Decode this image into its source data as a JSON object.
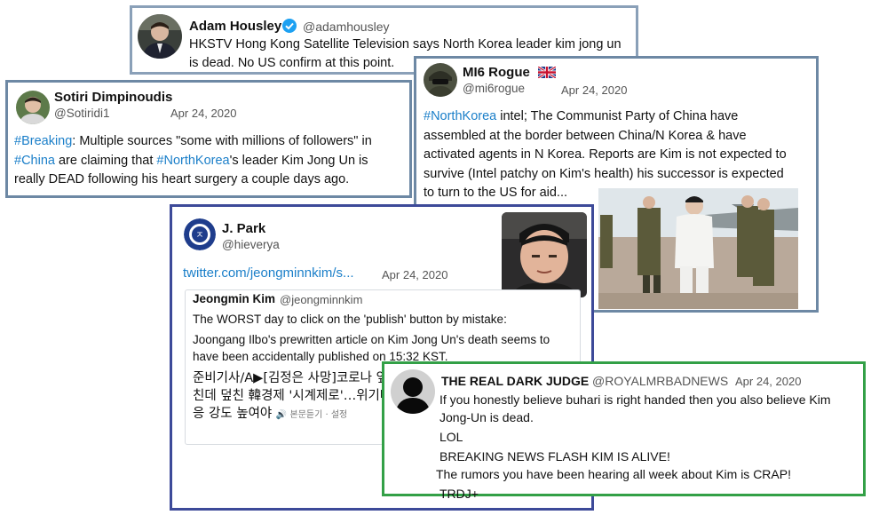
{
  "tweets": {
    "adam": {
      "name": "Adam Housley",
      "handle": "@adamhousley",
      "text_line1": "HKSTV Hong Kong Satellite Television says North Korea leader kim jong un",
      "text_line2": "is dead. No US confirm at this point."
    },
    "sotiri": {
      "name": "Sotiri Dimpinoudis",
      "handle": "@Sotiridi1",
      "date": "Apr 24, 2020",
      "l1_tag": "#Breaking",
      "l1_rest": ": Multiple sources \"some with millions of followers\" in",
      "l2_tag": "#China",
      "l2_mid": " are claiming that ",
      "l2_tag2": "#NorthKorea",
      "l2_rest": "'s leader Kim Jong Un is",
      "l3": "really DEAD following his heart surgery a couple days ago."
    },
    "mi6": {
      "name": "MI6 Rogue",
      "handle": "@mi6rogue",
      "date": "Apr 24, 2020",
      "l1_tag": "#NorthKorea",
      "l1_rest": " intel; The Communist Party of China have",
      "l2": "assembled at the border between China/N Korea & have",
      "l3": "activated agents in N Korea. Reports are Kim is not expected to",
      "l4": "survive (Intel patchy on Kim's health) his successor is expected",
      "l5": "to turn to the US for aid..."
    },
    "park": {
      "name": "J. Park",
      "handle": "@hieverya",
      "link": "twitter.com/jeongminnkim/s...",
      "date": "Apr 24, 2020",
      "quote": {
        "name": "Jeongmin Kim",
        "handle": "@jeongminnkim",
        "l1": "The WORST day to click on the 'publish' button by mistake:",
        "l2": "Joongang Ilbo's prewritten article on Kim Jong Un's death seems to",
        "l3": "have been accidentally published on 15:32 KST.",
        "k1": "준비기사/A▶[김정은 사망]코로나 엎",
        "k2": "친데 덮친 韓경제 '시계제로'…위기대",
        "k3": "응 강도 높여야",
        "k3_small": "🔊 본문듣기 · 설정"
      }
    },
    "judge": {
      "name": "THE REAL DARK JUDGE",
      "handle": "@ROYALMRBADNEWS",
      "date": "Apr 24, 2020",
      "l1": "If you honestly believe buhari is right handed then you also believe Kim",
      "l2": "Jong-Un is dead.",
      "l3": "LOL",
      "l4": "BREAKING NEWS FLASH KIM IS ALIVE!",
      "l5": "The rumors you have been hearing all week about Kim is CRAP!",
      "l6": "TRDJ+"
    }
  },
  "icons": {
    "verified": "verified-badge-icon",
    "flag": "uk-flag-icon"
  },
  "colors": {
    "hashtag": "#1b7fc9",
    "frame_grey_blue": "#6d88a4",
    "frame_navy": "#3d4a99",
    "frame_green": "#33a047"
  }
}
